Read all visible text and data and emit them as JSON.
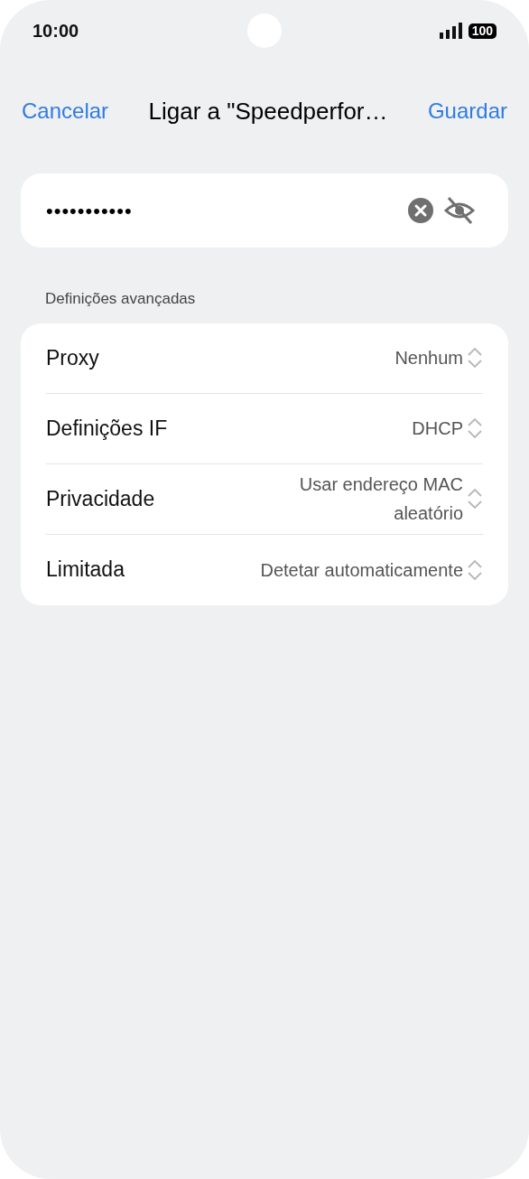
{
  "status_bar": {
    "time": "10:00",
    "battery": "100"
  },
  "header": {
    "cancel": "Cancelar",
    "title": "Ligar a \"Speedperfor…",
    "save": "Guardar"
  },
  "password_field": {
    "value": "•••••••••••",
    "masked": true
  },
  "section_title": "Definições avançadas",
  "settings": [
    {
      "label": "Proxy",
      "value": "Nenhum"
    },
    {
      "label": "Definições IF",
      "value": "DHCP"
    },
    {
      "label": "Privacidade",
      "value": "Usar endereço MAC aleatório"
    },
    {
      "label": "Limitada",
      "value": "Detetar automaticamente"
    }
  ]
}
